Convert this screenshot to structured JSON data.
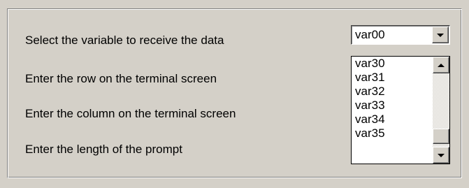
{
  "form": {
    "labels": [
      "Select the variable to receive the data",
      "Enter the row on the terminal screen",
      "Enter the column on the terminal screen",
      "Enter the length of the prompt"
    ]
  },
  "variable_combo": {
    "selected": "var00",
    "options": [
      "var30",
      "var31",
      "var32",
      "var33",
      "var34",
      "var35"
    ]
  },
  "icons": {
    "dropdown": "chevron-down-icon",
    "scroll_up": "scroll-up-icon",
    "scroll_down": "scroll-down-icon"
  }
}
